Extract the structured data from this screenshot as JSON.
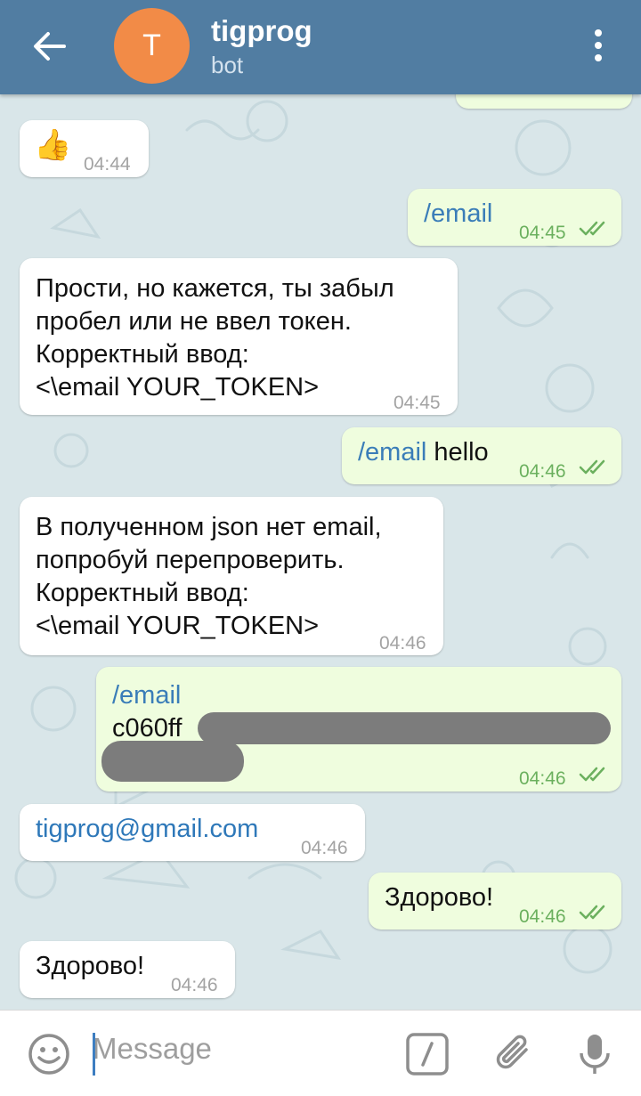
{
  "header": {
    "title": "tigprog",
    "subtitle": "bot",
    "avatar_letter": "T"
  },
  "messages": [
    {
      "side": "in",
      "type": "sticker",
      "text": "👍",
      "time": "04:44"
    },
    {
      "side": "out",
      "type": "command",
      "command": "/email",
      "time": "04:45",
      "status": "read"
    },
    {
      "side": "in",
      "lines": [
        "Прости, но кажется, ты забыл",
        "пробел или не ввел токен.",
        "Корректный ввод:",
        "<\\email YOUR_TOKEN>"
      ],
      "time": "04:45"
    },
    {
      "side": "out",
      "command": "/email",
      "text": " hello",
      "time": "04:46",
      "status": "read"
    },
    {
      "side": "in",
      "lines": [
        "В полученном json нет email,",
        "попробуй перепроверить.",
        "Корректный ввод:",
        "<\\email YOUR_TOKEN>"
      ],
      "time": "04:46"
    },
    {
      "side": "out",
      "command": "/email",
      "text": "c060ff",
      "redacted": true,
      "time": "04:46",
      "status": "read"
    },
    {
      "side": "in",
      "text": "tigprog@gmail.com",
      "time": "04:46"
    },
    {
      "side": "out",
      "text": "Здорово!",
      "time": "04:46",
      "status": "read"
    },
    {
      "side": "in",
      "text": "Здорово!",
      "time": "04:46"
    }
  ],
  "composer": {
    "placeholder": "Message"
  },
  "icons": [
    "back-arrow-icon",
    "more-vertical-icon",
    "emoji-icon",
    "bot-command-icon",
    "attach-icon",
    "microphone-icon",
    "double-check-icon"
  ],
  "colors": {
    "header": "#517da2",
    "avatar": "#f28b47",
    "outgoing_bubble": "#effdde",
    "incoming_bubble": "#ffffff",
    "link": "#2e78b9",
    "check": "#6bb05e"
  }
}
